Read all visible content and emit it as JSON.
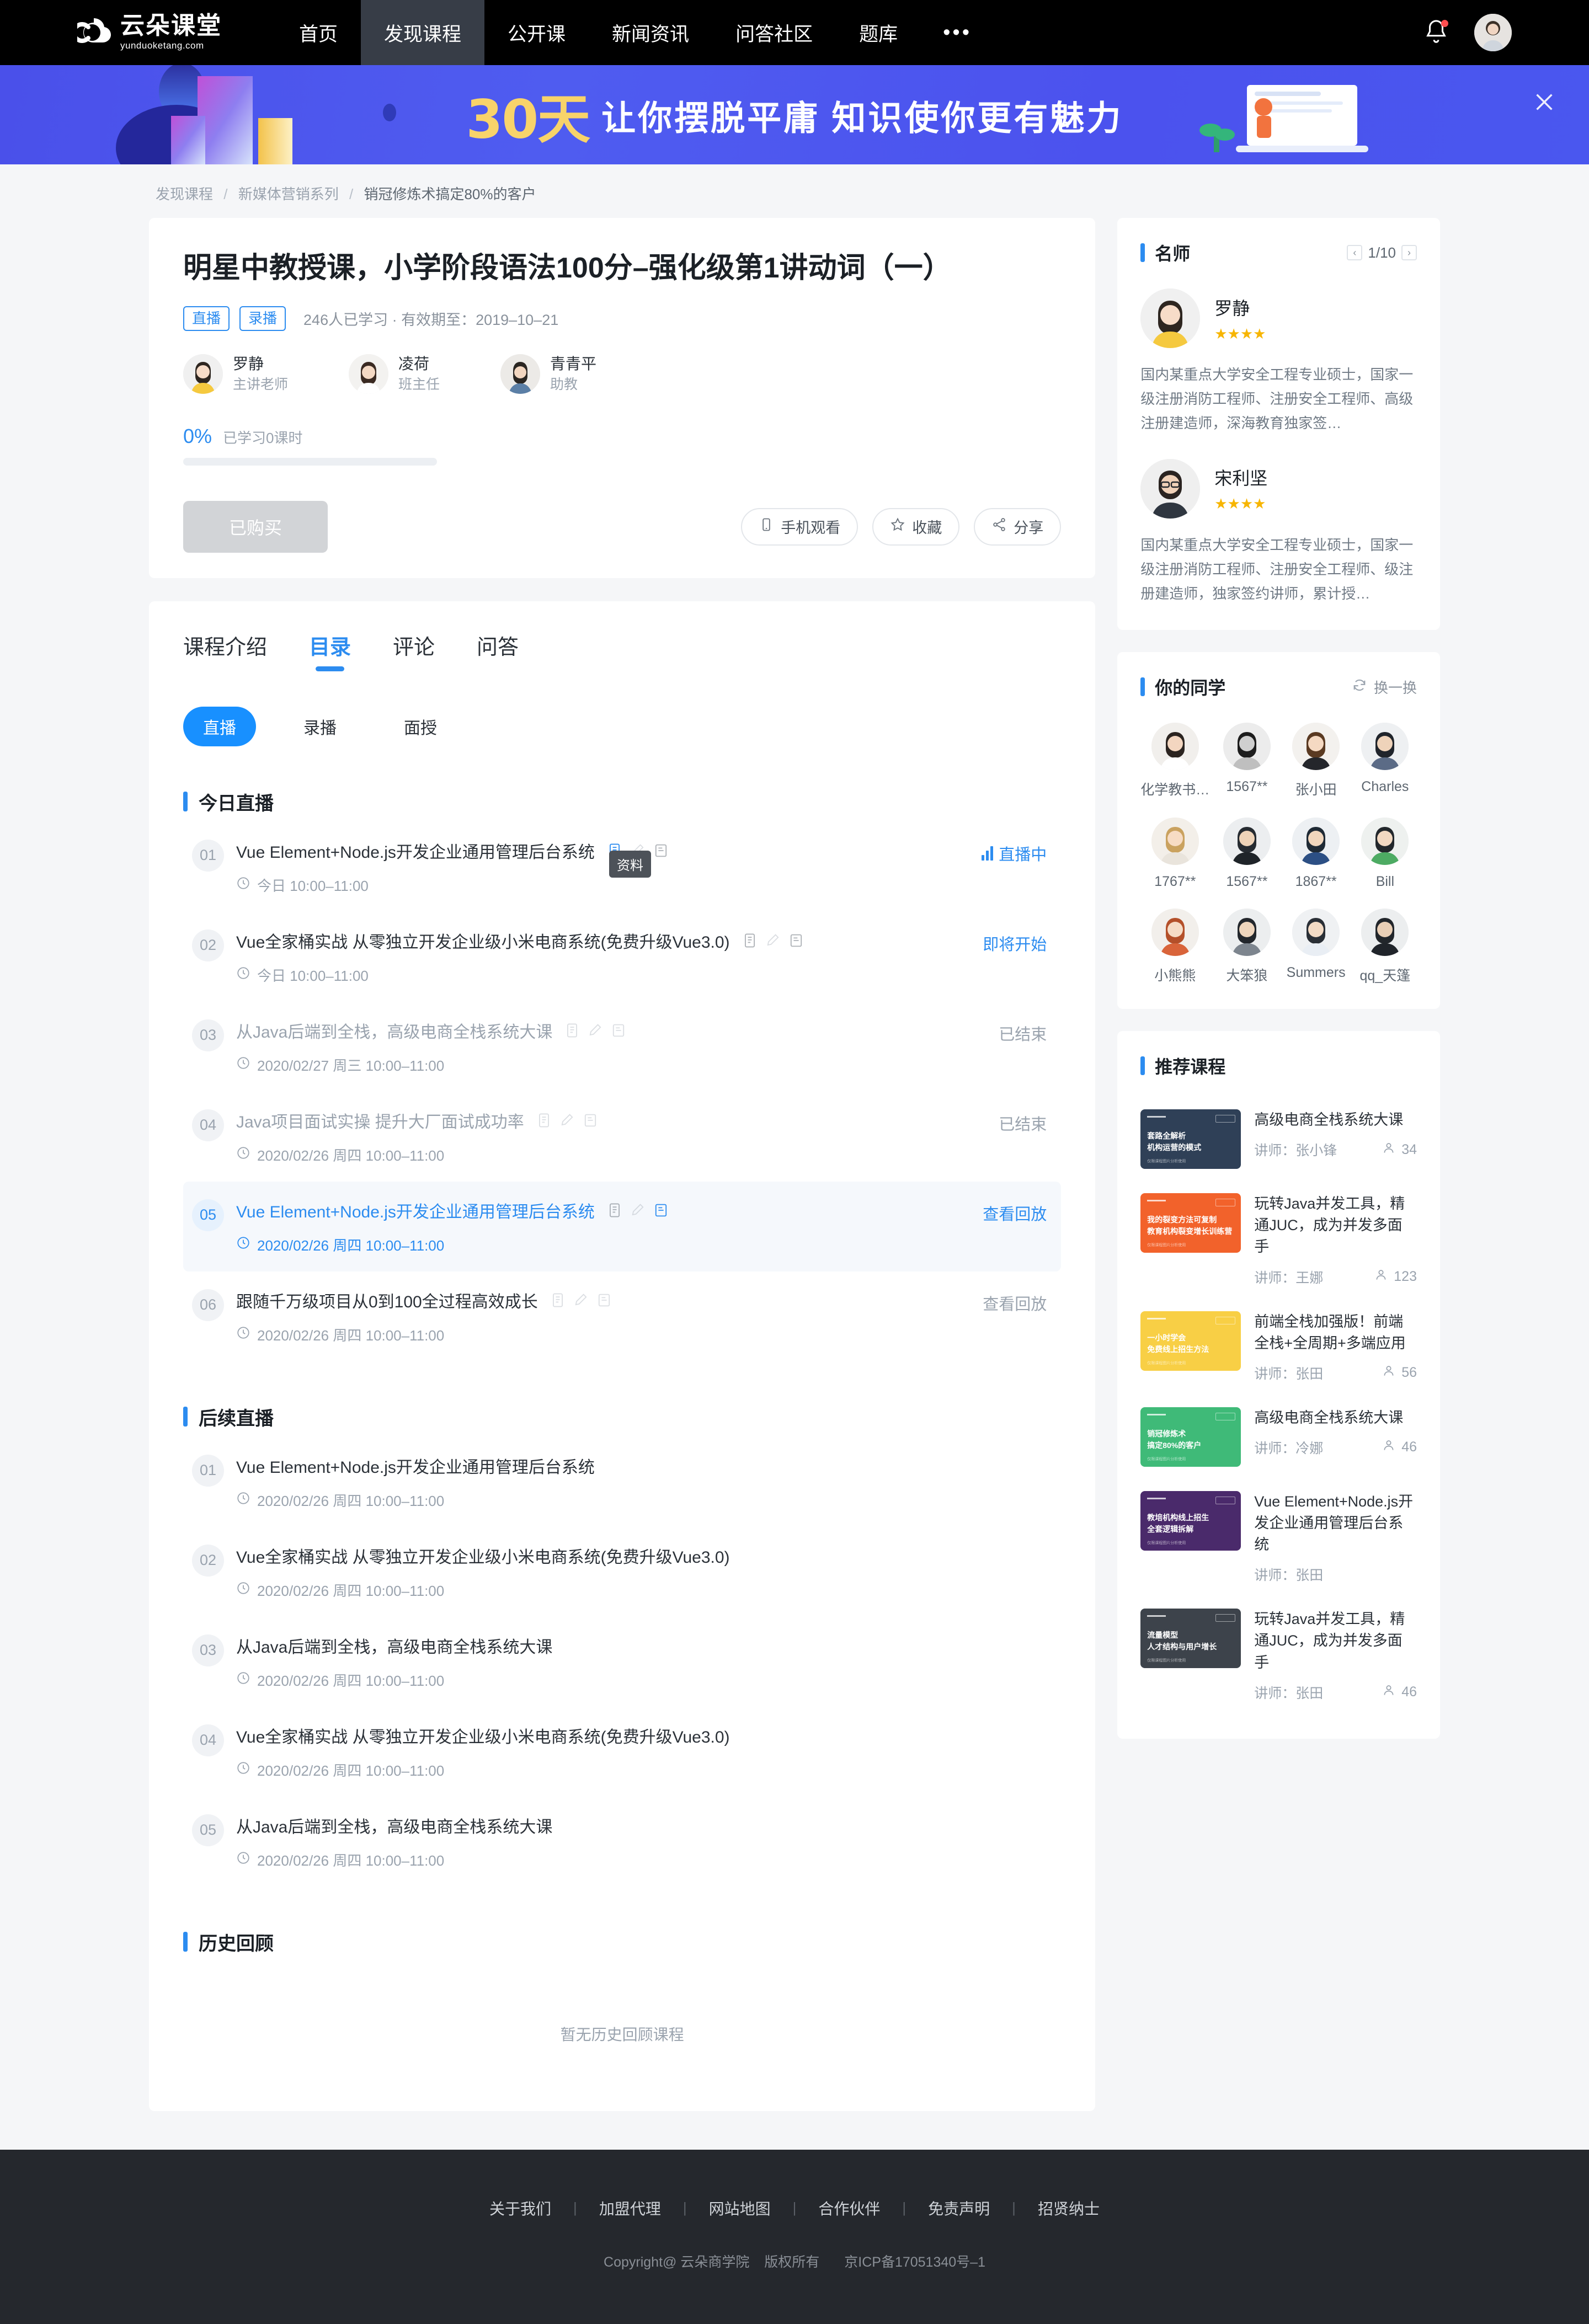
{
  "nav": {
    "logo_cn": "云朵课堂",
    "logo_en": "yunduoketang.com",
    "items": [
      {
        "label": "首页",
        "active": false
      },
      {
        "label": "发现课程",
        "active": true
      },
      {
        "label": "公开课",
        "active": false
      },
      {
        "label": "新闻资讯",
        "active": false
      },
      {
        "label": "问答社区",
        "active": false
      },
      {
        "label": "题库",
        "active": false
      }
    ],
    "more": "•••",
    "bell_icon": "bell-icon",
    "avatar_icon": "user-avatar"
  },
  "banner": {
    "highlight": "30天",
    "text": "让你摆脱平庸 知识使你更有魅力",
    "close_icon": "close-icon"
  },
  "breadcrumb": {
    "items": [
      "发现课程",
      "新媒体营销系列",
      "销冠修炼术搞定80%的客户"
    ],
    "separator": "/"
  },
  "course": {
    "title": "明星中教授课，小学阶段语法100分–强化级第1讲动词（一）",
    "tags": [
      "直播",
      "录播"
    ],
    "meta": "246人已学习 · 有效期至：2019–10–21",
    "teachers": [
      {
        "name": "罗静",
        "role": "主讲老师"
      },
      {
        "name": "凌荷",
        "role": "班主任"
      },
      {
        "name": "青青平",
        "role": "助教"
      }
    ],
    "progress_pct": "0%",
    "progress_label": "已学习0课时",
    "progress_value": 0,
    "buy_button": "已购买",
    "actions": [
      {
        "label": "手机观看",
        "icon": "mobile-icon"
      },
      {
        "label": "收藏",
        "icon": "star-icon"
      },
      {
        "label": "分享",
        "icon": "share-icon"
      }
    ]
  },
  "tabs": [
    {
      "label": "课程介绍",
      "active": false
    },
    {
      "label": "目录",
      "active": true
    },
    {
      "label": "评论",
      "active": false
    },
    {
      "label": "问答",
      "active": false
    }
  ],
  "chips": [
    {
      "label": "直播",
      "active": true
    },
    {
      "label": "录播",
      "active": false
    },
    {
      "label": "面授",
      "active": false
    }
  ],
  "sections": [
    {
      "title": "今日直播",
      "lessons": [
        {
          "num": "01",
          "title": "Vue Element+Node.js开发企业通用管理后台系统",
          "time": "今日 10:00–11:00",
          "status": "直播中",
          "state": "live",
          "icons": [
            "doc-icon",
            "pencil-icon",
            "note-icon"
          ],
          "tooltip": "资料"
        },
        {
          "num": "02",
          "title": "Vue全家桶实战 从零独立开发企业级小米电商系统(免费升级Vue3.0)",
          "time": "今日 10:00–11:00",
          "status": "即将开始",
          "state": "soon",
          "icons": [
            "doc-icon",
            "pencil-icon",
            "note-icon"
          ]
        },
        {
          "num": "03",
          "title": "从Java后端到全栈，高级电商全栈系统大课",
          "time": "2020/02/27 周三 10:00–11:00",
          "status": "已结束",
          "state": "ended",
          "icons": [
            "doc-icon",
            "pencil-icon",
            "note-icon"
          ]
        },
        {
          "num": "04",
          "title": "Java项目面试实操 提升大厂面试成功率",
          "time": "2020/02/26 周四 10:00–11:00",
          "status": "已结束",
          "state": "ended",
          "icons": [
            "doc-icon",
            "pencil-icon",
            "note-icon"
          ]
        },
        {
          "num": "05",
          "title": "Vue Element+Node.js开发企业通用管理后台系统",
          "time": "2020/02/26 周四 10:00–11:00",
          "status": "查看回放",
          "state": "replay-active",
          "icons": [
            "doc-icon",
            "pencil-icon",
            "note-icon"
          ]
        },
        {
          "num": "06",
          "title": "跟随千万级项目从0到100全过程高效成长",
          "time": "2020/02/26 周四 10:00–11:00",
          "status": "查看回放",
          "state": "replay",
          "icons": [
            "doc-icon",
            "pencil-icon",
            "note-icon"
          ]
        }
      ]
    },
    {
      "title": "后续直播",
      "lessons": [
        {
          "num": "01",
          "title": "Vue Element+Node.js开发企业通用管理后台系统",
          "time": "2020/02/26 周四 10:00–11:00",
          "status": "",
          "state": "plain",
          "icons": []
        },
        {
          "num": "02",
          "title": "Vue全家桶实战 从零独立开发企业级小米电商系统(免费升级Vue3.0)",
          "time": "2020/02/26 周四 10:00–11:00",
          "status": "",
          "state": "plain",
          "icons": []
        },
        {
          "num": "03",
          "title": "从Java后端到全栈，高级电商全栈系统大课",
          "time": "2020/02/26 周四 10:00–11:00",
          "status": "",
          "state": "plain",
          "icons": []
        },
        {
          "num": "04",
          "title": "Vue全家桶实战 从零独立开发企业级小米电商系统(免费升级Vue3.0)",
          "time": "2020/02/26 周四 10:00–11:00",
          "status": "",
          "state": "plain",
          "icons": []
        },
        {
          "num": "05",
          "title": "从Java后端到全栈，高级电商全栈系统大课",
          "time": "2020/02/26 周四 10:00–11:00",
          "status": "",
          "state": "plain",
          "icons": []
        }
      ]
    },
    {
      "title": "历史回顾",
      "empty_text": "暂无历史回顾课程",
      "lessons": []
    }
  ],
  "side": {
    "famous": {
      "title": "名师",
      "page": "1/10",
      "prev_icon": "chevron-left-icon",
      "next_icon": "chevron-right-icon",
      "teachers": [
        {
          "name": "罗静",
          "stars": 4,
          "desc": "国内某重点大学安全工程专业硕士，国家一级注册消防工程师、注册安全工程师、高级注册建造师，深海教育独家签…"
        },
        {
          "name": "宋利坚",
          "stars": 4,
          "desc": "国内某重点大学安全工程专业硕士，国家一级注册消防工程师、注册安全工程师、级注册建造师，独家签约讲师，累计授…"
        }
      ]
    },
    "classmates": {
      "title": "你的同学",
      "refresh_label": "换一换",
      "refresh_icon": "refresh-icon",
      "people": [
        {
          "name": "化学教书…"
        },
        {
          "name": "1567**"
        },
        {
          "name": "张小田"
        },
        {
          "name": "Charles"
        },
        {
          "name": "1767**"
        },
        {
          "name": "1567**"
        },
        {
          "name": "1867**"
        },
        {
          "name": "Bill"
        },
        {
          "name": "小熊熊"
        },
        {
          "name": "大笨狼"
        },
        {
          "name": "Summers"
        },
        {
          "name": "qq_天篷"
        }
      ]
    },
    "recommend": {
      "title": "推荐课程",
      "teacher_prefix": "讲师：",
      "courses": [
        {
          "title": "高级电商全栈系统大课",
          "teacher": "张小锋",
          "count": "34",
          "thumb_color": "#2f4057",
          "thumb_l1": "套路全解析",
          "thumb_l2": "机构运营的模式",
          "thumb_foot": "仅限课程图片分析使用"
        },
        {
          "title": "玩转Java并发工具，精通JUC，成为并发多面手",
          "teacher": "王娜",
          "count": "123",
          "thumb_color": "#f2622b",
          "thumb_l1": "我的裂变方法可复制",
          "thumb_l2": "教育机构裂变增长训练营",
          "thumb_foot": "仅限课程图片分析使用"
        },
        {
          "title": "前端全栈加强版！前端全栈+全周期+多端应用",
          "teacher": "张田",
          "count": "56",
          "thumb_color": "#f8cf45",
          "thumb_l1": "一小时学会",
          "thumb_l2": "免费线上招生方法",
          "thumb_foot": "仅限课程图片分析使用"
        },
        {
          "title": "高级电商全栈系统大课",
          "teacher": "冷娜",
          "count": "46",
          "thumb_color": "#3fba78",
          "thumb_l1": "销冠修炼术",
          "thumb_l2": "搞定80%的客户",
          "thumb_foot": "仅限课程图片分析使用"
        },
        {
          "title": "Vue Element+Node.js开发企业通用管理后台系统",
          "teacher": "张田",
          "count": "",
          "thumb_color": "#4a2a6b",
          "thumb_l1": "教培机构线上招生",
          "thumb_l2": "全套逻辑拆解",
          "thumb_foot": "仅限课程图片分析使用"
        },
        {
          "title": "玩转Java并发工具，精通JUC，成为并发多面手",
          "teacher": "张田",
          "count": "46",
          "thumb_color": "#3d434b",
          "thumb_l1": "流量模型",
          "thumb_l2": "人才结构与用户增长",
          "thumb_foot": "仅限课程图片分析使用"
        }
      ]
    }
  },
  "footer": {
    "links": [
      "关于我们",
      "加盟代理",
      "网站地图",
      "合作伙伴",
      "免责声明",
      "招贤纳士"
    ],
    "copyright": "Copyright@ 云朵商学院",
    "rights": "版权所有",
    "icp": "京ICP备17051340号–1"
  },
  "colors": {
    "accent": "#2c8cf0",
    "brand_blue": "#1890ff",
    "banner_yellow": "#f8d36a",
    "nav_bg": "#000000",
    "footer_bg": "#25282d"
  }
}
